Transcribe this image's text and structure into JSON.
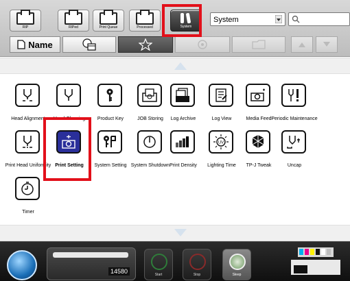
{
  "toolbar": {
    "tabs": [
      {
        "label": "RIP"
      },
      {
        "label": "RIPed"
      },
      {
        "label": "Print Queue"
      },
      {
        "label": "Processed"
      },
      {
        "label": "System"
      }
    ],
    "select_value": "System"
  },
  "sortbar": {
    "name_label": "Name"
  },
  "grid": {
    "items": [
      {
        "label": "Head Alignment",
        "icon": "head-alignment-icon"
      },
      {
        "label": "Head Cleaning",
        "icon": "head-cleaning-icon"
      },
      {
        "label": "Product Key",
        "icon": "key-icon"
      },
      {
        "label": "JOB Storing",
        "icon": "job-storing-icon"
      },
      {
        "label": "Log Archive",
        "icon": "log-archive-icon"
      },
      {
        "label": "Log View",
        "icon": "log-view-icon"
      },
      {
        "label": "Media Feed",
        "icon": "media-feed-icon"
      },
      {
        "label": "Periodic Maintenance",
        "icon": "periodic-maintenance-icon"
      },
      {
        "label": "Print Head Uniformity",
        "icon": "print-head-uniformity-icon"
      },
      {
        "label": "Print Setting",
        "icon": "print-setting-icon"
      },
      {
        "label": "System Setting",
        "icon": "system-setting-icon"
      },
      {
        "label": "System Shutdown",
        "icon": "power-icon"
      },
      {
        "label": "Print Density",
        "icon": "print-density-icon"
      },
      {
        "label": "Lighting Time",
        "icon": "uv-lamp-icon"
      },
      {
        "label": "TP-J Tweak",
        "icon": "tpj-tweak-icon"
      },
      {
        "label": "Uncap",
        "icon": "uncap-icon"
      },
      {
        "label": "Timer",
        "icon": "timer-icon"
      }
    ]
  },
  "status": {
    "counter": "14580",
    "btn1": "Start",
    "btn2": "Stop",
    "sleep": "Sleep"
  },
  "colors": {
    "highlight": "#e2101a",
    "selected": "#2a2f9a"
  }
}
